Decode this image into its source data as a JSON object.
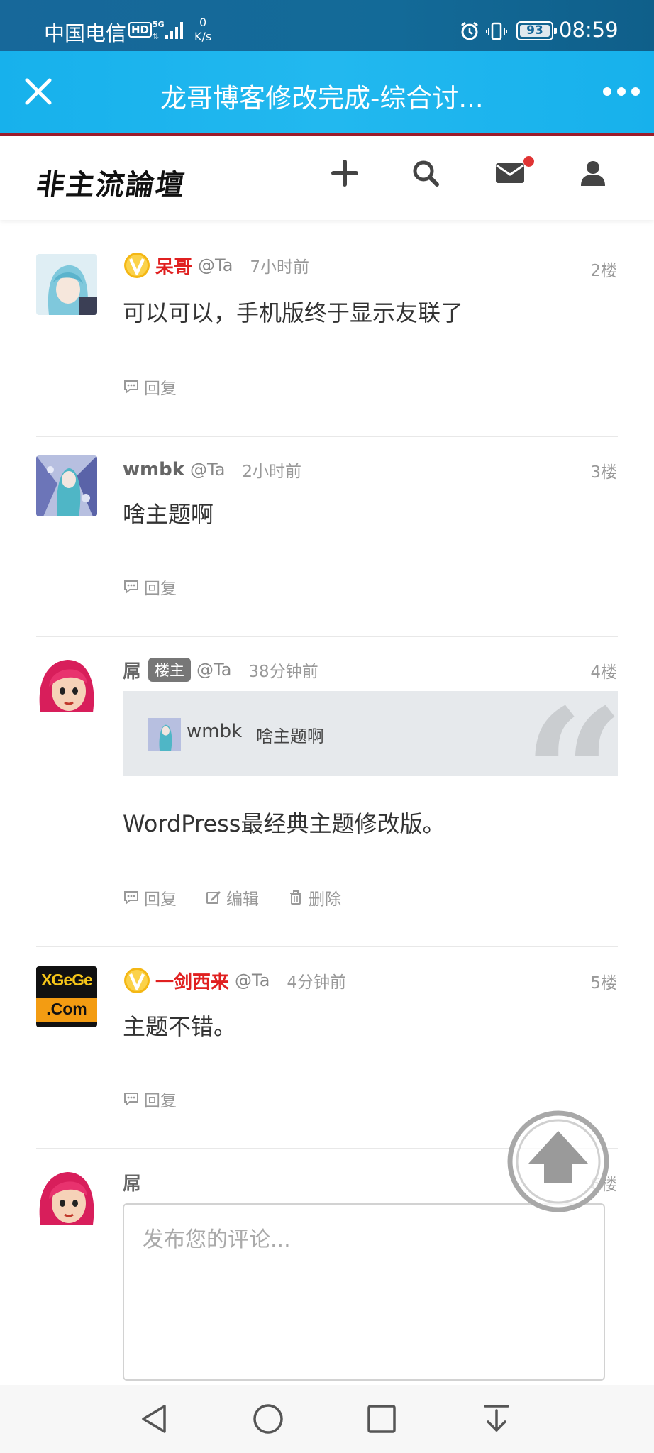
{
  "status_bar": {
    "carrier": "中国电信",
    "hd": "HD",
    "speed_value": "0",
    "speed_unit": "K/s",
    "battery": "93",
    "time": "08:59"
  },
  "app_bar": {
    "title": "龙哥博客修改完成-综合讨..."
  },
  "site": {
    "logo": "非主流論壇",
    "notification_dot_color": "#e03434"
  },
  "comments": [
    {
      "author": "呆哥",
      "vip": true,
      "at": "@Ta",
      "time": "7小时前",
      "floor": "2楼",
      "content": "可以可以，手机版终于显示友联了",
      "actions": [
        "回复"
      ]
    },
    {
      "author": "wmbk",
      "vip": false,
      "at": "@Ta",
      "time": "2小时前",
      "floor": "3楼",
      "content": "啥主题啊",
      "actions": [
        "回复"
      ]
    },
    {
      "author": "屌",
      "owner_tag": "楼主",
      "at": "@Ta",
      "time": "38分钟前",
      "floor": "4楼",
      "quote": {
        "author": "wmbk",
        "text": "啥主题啊"
      },
      "content": "WordPress最经典主题修改版。",
      "actions": [
        "回复",
        "编辑",
        "删除"
      ]
    },
    {
      "author": "一剑西来",
      "vip": true,
      "avatar_text_1": "XGeGe",
      "avatar_text_2": ".Com",
      "at": "@Ta",
      "time": "4分钟前",
      "floor": "5楼",
      "content": "主题不错。",
      "actions": [
        "回复"
      ]
    }
  ],
  "reply_form": {
    "author": "屌",
    "floor": "6楼",
    "placeholder": "发布您的评论..."
  },
  "colors": {
    "vip_name": "#e02020",
    "app_bar": "#1fb5ee",
    "status_bar": "#17689a"
  }
}
